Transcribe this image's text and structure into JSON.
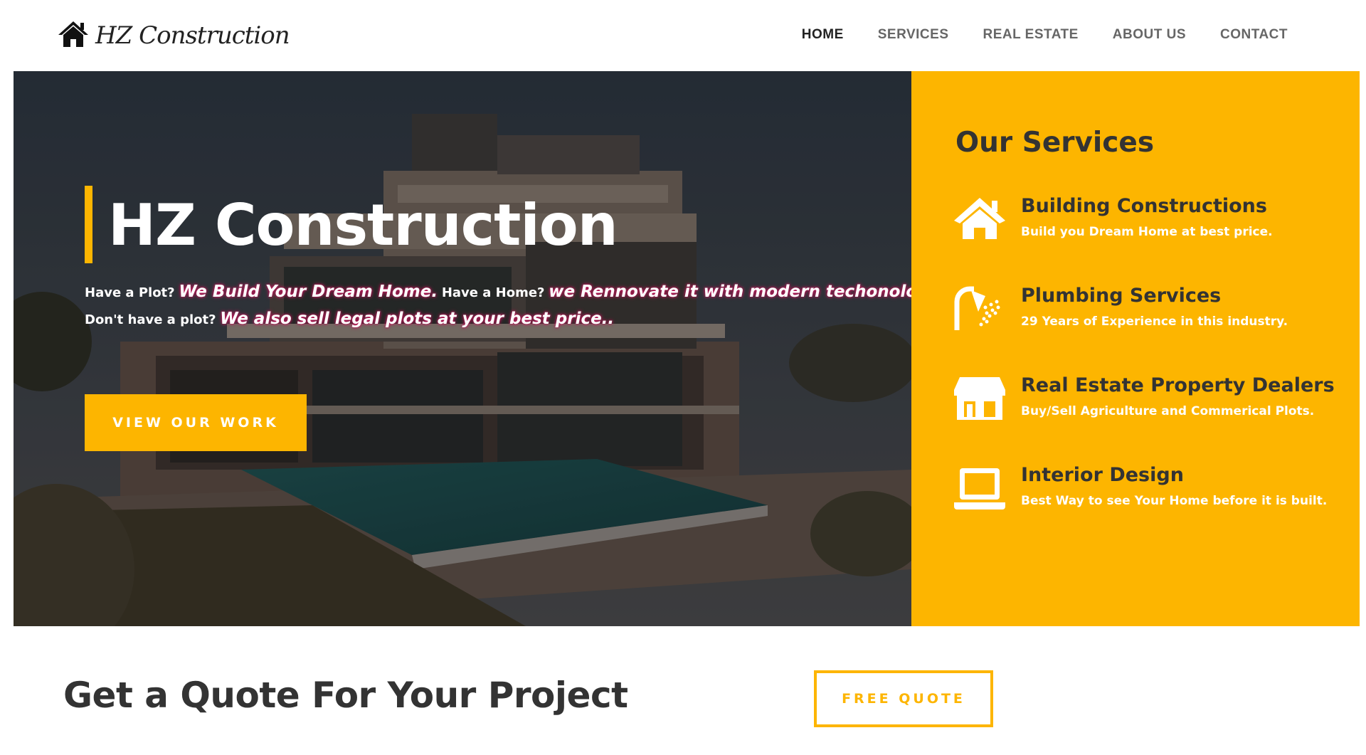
{
  "header": {
    "logo_text": "HZ Construction",
    "logo_icon": "house-icon",
    "nav": [
      {
        "label": "HOME",
        "active": true
      },
      {
        "label": "SERVICES",
        "active": false
      },
      {
        "label": "REAL ESTATE",
        "active": false
      },
      {
        "label": "ABOUT US",
        "active": false
      },
      {
        "label": "CONTACT",
        "active": false
      }
    ]
  },
  "hero": {
    "title": "HZ Construction",
    "line1": {
      "q1": "Have a Plot?",
      "a1": "We Build Your Dream Home.",
      "q2": "Have a Home?",
      "a2": "we Rennovate it with modern techonology."
    },
    "line2": {
      "q1": "Don't have a plot?",
      "a1": "We also sell legal plots at your best price.."
    },
    "button_label": "VIEW OUR WORK"
  },
  "services": {
    "title": "Our Services",
    "items": [
      {
        "icon": "house-icon",
        "title": "Building Constructions",
        "desc": "Build you Dream Home at best price."
      },
      {
        "icon": "shower-icon",
        "title": "Plumbing Services",
        "desc": "29 Years of Experience in this industry."
      },
      {
        "icon": "storefront-icon",
        "title": "Real Estate Property Dealers",
        "desc": "Buy/Sell Agriculture and Commerical Plots."
      },
      {
        "icon": "laptop-icon",
        "title": "Interior Design",
        "desc": "Best Way to see Your Home before it is built."
      }
    ]
  },
  "quote": {
    "heading": "Get a Quote For Your Project",
    "button_label": "FREE QUOTE"
  },
  "colors": {
    "accent": "#fdb500",
    "dark_text": "#333333",
    "nav_text": "#666666"
  }
}
